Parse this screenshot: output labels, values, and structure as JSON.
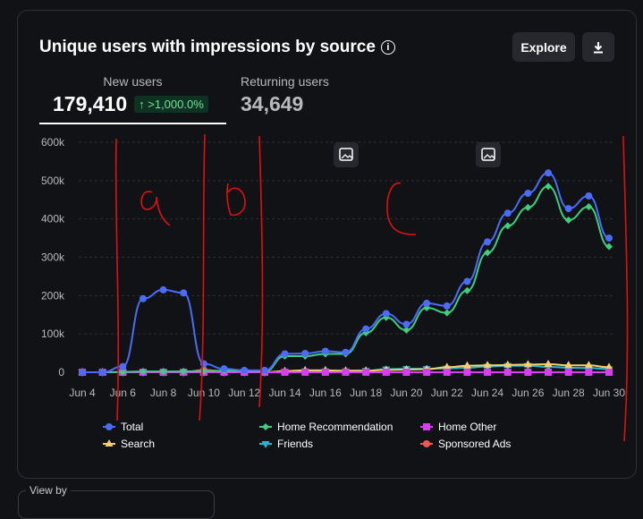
{
  "header": {
    "title": "Unique users with impressions by source",
    "explore_label": "Explore"
  },
  "tabs": [
    {
      "label": "New users",
      "value": "179,410",
      "change": "↑ >1,000.0%"
    },
    {
      "label": "Returning users",
      "value": "34,649"
    }
  ],
  "view_by_label": "View by",
  "annotations": [
    "a",
    "b",
    "c"
  ],
  "chart_data": {
    "type": "line",
    "x": [
      "Jun 4",
      "Jun 5",
      "Jun 6",
      "Jun 7",
      "Jun 8",
      "Jun 9",
      "Jun 10",
      "Jun 11",
      "Jun 12",
      "Jun 13",
      "Jun 14",
      "Jun 15",
      "Jun 16",
      "Jun 17",
      "Jun 18",
      "Jun 19",
      "Jun 20",
      "Jun 21",
      "Jun 22",
      "Jun 23",
      "Jun 24",
      "Jun 25",
      "Jun 26",
      "Jun 27",
      "Jun 28",
      "Jun 29",
      "Jun 30"
    ],
    "xticks": [
      "Jun 4",
      "Jun 6",
      "Jun 8",
      "Jun 10",
      "Jun 12",
      "Jun 14",
      "Jun 16",
      "Jun 18",
      "Jun 20",
      "Jun 22",
      "Jun 24",
      "Jun 26",
      "Jun 28",
      "Jun 30"
    ],
    "yticks": [
      0,
      100000,
      200000,
      300000,
      400000,
      500000,
      600000
    ],
    "ytick_labels": [
      "0",
      "100k",
      "200k",
      "300k",
      "400k",
      "500k",
      "600k"
    ],
    "ylim": [
      0,
      600000
    ],
    "grid": true,
    "legend_position": "bottom",
    "series": [
      {
        "name": "Total",
        "color": "#4a6cf7",
        "marker": "circle",
        "values": [
          0,
          0,
          15000,
          192000,
          215000,
          207000,
          22000,
          9000,
          5000,
          5000,
          48000,
          49000,
          55000,
          52000,
          113000,
          153000,
          125000,
          180000,
          173000,
          237000,
          340000,
          415000,
          467000,
          520000,
          427000,
          460000,
          350000
        ]
      },
      {
        "name": "Home Recommendation",
        "color": "#3ecf7e",
        "marker": "diamond",
        "values": [
          0,
          0,
          1000,
          2000,
          2000,
          2000,
          3000,
          4000,
          3000,
          2000,
          42000,
          42000,
          48000,
          48000,
          103000,
          143000,
          110000,
          168000,
          155000,
          213000,
          312000,
          382000,
          430000,
          485000,
          397000,
          432000,
          328000
        ]
      },
      {
        "name": "Home Other",
        "color": "#d63ef0",
        "marker": "square",
        "values": [
          0,
          0,
          0,
          0,
          0,
          0,
          0,
          0,
          0,
          0,
          0,
          0,
          0,
          0,
          0,
          0,
          0,
          0,
          0,
          0,
          0,
          0,
          0,
          0,
          0,
          0,
          0
        ]
      },
      {
        "name": "Search",
        "color": "#f5cf6b",
        "marker": "triangle-up",
        "values": [
          0,
          0,
          0,
          0,
          0,
          0,
          0,
          0,
          0,
          0,
          3000,
          5000,
          5000,
          4000,
          4000,
          6000,
          7000,
          8000,
          13000,
          17000,
          18000,
          19000,
          20000,
          21000,
          18000,
          18000,
          13000
        ]
      },
      {
        "name": "Friends",
        "color": "#22b8d8",
        "marker": "triangle-down",
        "values": [
          0,
          0,
          0,
          0,
          0,
          0,
          0,
          0,
          0,
          0,
          2000,
          3000,
          3000,
          3000,
          4000,
          8000,
          9000,
          9000,
          10000,
          12000,
          15000,
          17000,
          17000,
          14000,
          12000,
          11000,
          8000
        ]
      },
      {
        "name": "Sponsored Ads",
        "color": "#f0574f",
        "marker": "circle",
        "values": [
          0,
          0,
          0,
          0,
          0,
          0,
          6000,
          3000,
          1000,
          0,
          0,
          0,
          0,
          0,
          0,
          0,
          0,
          0,
          0,
          0,
          0,
          0,
          0,
          0,
          0,
          0,
          0
        ]
      }
    ]
  }
}
